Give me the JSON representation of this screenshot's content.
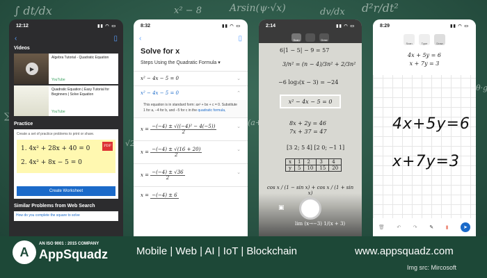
{
  "background": {
    "chalk_formulas": [
      "∫ dt/dx",
      "Arsin(ψ·√x)",
      "d²r/dt²",
      "x² − 8",
      "dv/dx",
      "∑ = 1",
      "√2·h",
      "(a+b)²",
      "θ·g"
    ]
  },
  "phone1": {
    "time": "12:12",
    "section_videos": "Videos",
    "videos": [
      {
        "title": "Algebra Tutorial - Quadratic Equation",
        "source": "YouTube"
      },
      {
        "title": "Quadratic Equation | Easy Tutorial for Beginners | Solve Equation",
        "source": "YouTube"
      }
    ],
    "section_practice": "Practice",
    "practice_desc": "Create a set of practice problems to print or share.",
    "worksheet_eq1": "1. 4x² + 28x + 40 = 0",
    "worksheet_eq2": "2. 4x² + 8x − 5 = 0",
    "pdf_badge": "PDF",
    "create_button": "Create Worksheet",
    "section_similar": "Similar Problems from Web Search",
    "similar_link": "How do you complete the square to solve"
  },
  "phone2": {
    "time": "8:32",
    "title": "Solve for x",
    "method": "Steps Using the Quadratic Formula",
    "step1": "x² − 4x − 5 = 0",
    "step2": "x² − 4x − 5 = 0",
    "explanation": "This equation is in standard form: ax² + bx + c = 0. Substitute 1 for a, −4 for b, and −5 for c in the",
    "explanation_link": "quadratic formula,",
    "eq1_lhs": "x =",
    "eq1_num": "−(−4) ± √((−4)² − 4(−5))",
    "eq1_den": "2",
    "eq2_lhs": "x =",
    "eq2_num": "−(−4) ± √(16 + 20)",
    "eq2_den": "2",
    "eq3_lhs": "x =",
    "eq3_num": "−(−4) ± √36",
    "eq3_den": "2",
    "eq4_lhs": "x =",
    "eq4_num": "−(−4) ± 6"
  },
  "phone3": {
    "time": "2:14",
    "tabs": [
      "Scan",
      "",
      "Draw"
    ],
    "line1": "6|1 − 5| − 9 = 57",
    "line2": "3/n² = (n − 4)/3n² + 2/3n²",
    "line3": "−6 log₃(x − 3) = −24",
    "focused": "x² − 4x − 5 = 0",
    "sys1": "8x + 2y = 46",
    "sys2": "7x + 37 = 47",
    "matrix": "[3 2; 5 4] [2 0; −1 1]",
    "table_x": [
      "x",
      "1",
      "2",
      "3",
      "4"
    ],
    "table_y": [
      "y",
      "5",
      "10",
      "15",
      "20"
    ],
    "trig": "cos x / (1 − sin x) + cos x / (1 + sin x)",
    "limit": "lim (x→−3) 1/(x + 3)"
  },
  "phone4": {
    "time": "8:29",
    "tabs": [
      "Scan",
      "Type",
      "Draw"
    ],
    "typed1": "4x + 5y = 6",
    "typed2": "x + 7y = 3",
    "hand1": "4x+5y=6",
    "hand2": "x+7y=3"
  },
  "footer": {
    "iso": "AN ISO 9001 : 2015 COMPANY",
    "brand": "AppSquadz",
    "logo_letter": "A",
    "tagline": "Mobile | Web | AI | IoT | Blockchain",
    "url": "www.appsquadz.com",
    "img_src": "Img src: Mircosoft"
  }
}
